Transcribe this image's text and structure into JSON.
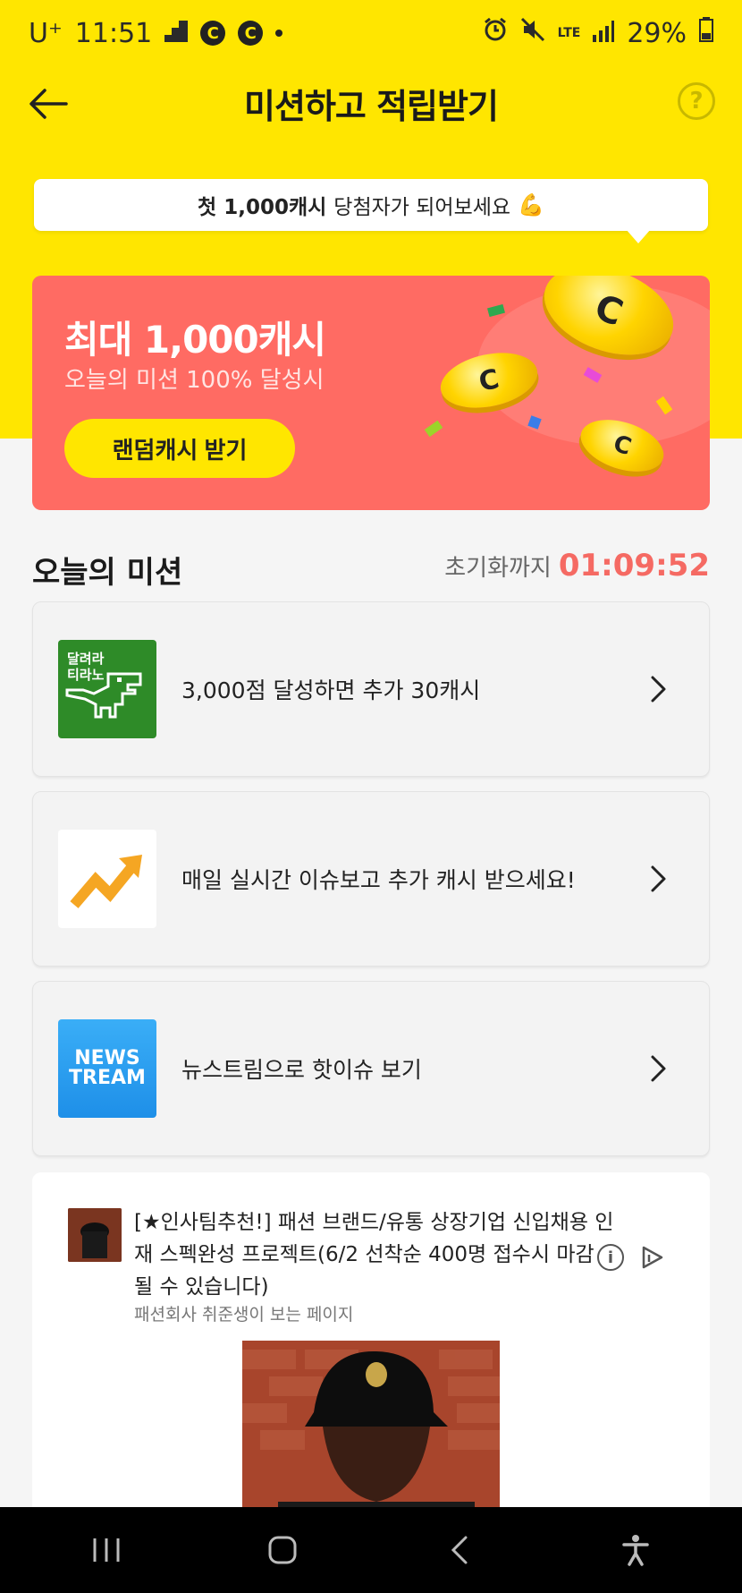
{
  "status_bar": {
    "carrier": "U⁺",
    "time": "11:51",
    "coin_a": "C",
    "coin_b": "C",
    "network": "LTE",
    "battery": "29%"
  },
  "header": {
    "title": "미션하고 적립받기",
    "help_label": "?"
  },
  "tooltip": {
    "bold": "첫 1,000캐시",
    "text": "당첨자가 되어보세요",
    "emoji": "💪"
  },
  "promo": {
    "title": "최대 1,000캐시",
    "subtitle": "오늘의 미션 100% 달성시",
    "button_label": "랜덤캐시 받기",
    "coin_mark": "C"
  },
  "missions_section": {
    "title": "오늘의 미션",
    "reset_label": "초기화까지",
    "reset_time": "01:09:52"
  },
  "missions": [
    {
      "thumb_text": "달려라\n티라노",
      "label": "3,000점 달성하면 추가 30캐시"
    },
    {
      "label": "매일 실시간 이슈보고 추가 캐시 받으세요!"
    },
    {
      "thumb_line1": "NEWS",
      "thumb_line2": "TREAM",
      "label": "뉴스트림으로 핫이슈 보기"
    }
  ],
  "ad": {
    "title": "[★인사팀추천!] 패션 브랜드/유통 상장기업 신입채용 인재 스펙완성 프로젝트(6/2 선착순 400명 접수시 마감 될 수 있습니다)",
    "source": "패션회사 취준생이 보는 페이지",
    "info_label": "i"
  },
  "colors": {
    "yellow": "#ffe600",
    "promo_red": "#ff6b63",
    "timer_red": "#f56a63"
  }
}
